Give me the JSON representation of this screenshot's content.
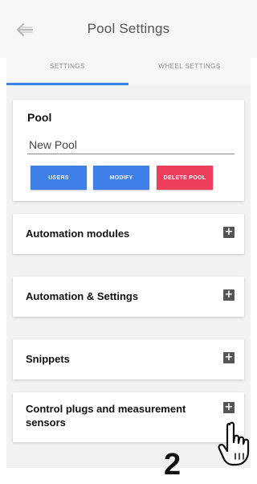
{
  "header": {
    "title": "Pool Settings",
    "back_icon": "back-arrow-icon"
  },
  "tabs": [
    {
      "label": "SETTINGS",
      "active": true
    },
    {
      "label": "WHEEL SETTINGS",
      "active": false
    }
  ],
  "pool_card": {
    "title": "Pool",
    "input_value": "New Pool",
    "buttons": {
      "users": "USERS",
      "modify": "MODIFY",
      "delete": "DELETE POOL"
    }
  },
  "sections": [
    {
      "label": "Automation modules",
      "icon": "plus-icon"
    },
    {
      "label": "Automation & Settings",
      "icon": "plus-icon"
    },
    {
      "label": "Snippets",
      "icon": "plus-icon"
    },
    {
      "label": "Control plugs and measurement sensors",
      "icon": "plus-icon"
    }
  ],
  "annotation": {
    "number": "2",
    "icon": "hand-pointer-icon"
  },
  "colors": {
    "primary": "#3f7fe8",
    "danger": "#ef3e5b",
    "header_bg": "#f7f7f7",
    "content_bg": "#f2f2f2"
  }
}
